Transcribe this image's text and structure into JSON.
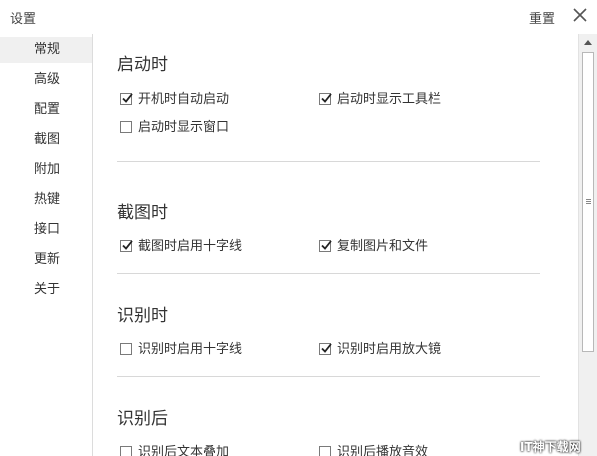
{
  "window": {
    "title": "设置",
    "reset_label": "重置"
  },
  "sidebar": {
    "items": [
      {
        "label": "常规",
        "active": true
      },
      {
        "label": "高级"
      },
      {
        "label": "配置"
      },
      {
        "label": "截图"
      },
      {
        "label": "附加"
      },
      {
        "label": "热键"
      },
      {
        "label": "接口"
      },
      {
        "label": "更新"
      },
      {
        "label": "关于"
      }
    ]
  },
  "sections": [
    {
      "title": "启动时",
      "options": [
        {
          "label": "开机时自动启动",
          "checked": true
        },
        {
          "label": "启动时显示工具栏",
          "checked": true
        },
        {
          "label": "启动时显示窗口",
          "checked": false
        }
      ]
    },
    {
      "title": "截图时",
      "options": [
        {
          "label": "截图时启用十字线",
          "checked": true
        },
        {
          "label": "复制图片和文件",
          "checked": true
        }
      ]
    },
    {
      "title": "识别时",
      "options": [
        {
          "label": "识别时启用十字线",
          "checked": false
        },
        {
          "label": "识别时启用放大镜",
          "checked": true
        }
      ]
    },
    {
      "title": "识别后",
      "options": [
        {
          "label": "识别后文本叠加",
          "checked": false
        },
        {
          "label": "识别后播放音效",
          "checked": false
        }
      ]
    }
  ],
  "watermark": "IT神下载网"
}
